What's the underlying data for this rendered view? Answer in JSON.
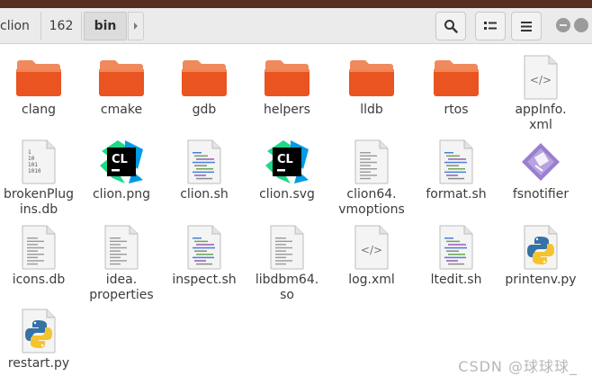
{
  "toolbar": {
    "breadcrumbs": [
      "clion",
      "162",
      "bin"
    ],
    "next_icon": "chevron-right-icon",
    "search_icon": "search-icon",
    "view_icon": "view-options-icon",
    "menu_icon": "hamburger-menu-icon"
  },
  "window_controls": [
    "minimize",
    "close"
  ],
  "files": [
    {
      "name": "clang",
      "type": "folder"
    },
    {
      "name": "cmake",
      "type": "folder"
    },
    {
      "name": "gdb",
      "type": "folder"
    },
    {
      "name": "helpers",
      "type": "folder"
    },
    {
      "name": "lldb",
      "type": "folder"
    },
    {
      "name": "rtos",
      "type": "folder"
    },
    {
      "name": "appInfo.\nxml",
      "type": "xml"
    },
    {
      "name": "brokenPlug\nins.db",
      "type": "binary"
    },
    {
      "name": "clion.png",
      "type": "clion-image"
    },
    {
      "name": "clion.sh",
      "type": "script"
    },
    {
      "name": "clion.svg",
      "type": "clion-image"
    },
    {
      "name": "clion64.\nvmoptions",
      "type": "text"
    },
    {
      "name": "format.sh",
      "type": "script"
    },
    {
      "name": "fsnotifier",
      "type": "executable"
    },
    {
      "name": "icons.db",
      "type": "text"
    },
    {
      "name": "idea.\nproperties",
      "type": "text"
    },
    {
      "name": "inspect.sh",
      "type": "script"
    },
    {
      "name": "libdbm64.\nso",
      "type": "text"
    },
    {
      "name": "log.xml",
      "type": "xml"
    },
    {
      "name": "ltedit.sh",
      "type": "script"
    },
    {
      "name": "printenv.py",
      "type": "python"
    },
    {
      "name": "restart.py",
      "type": "python"
    }
  ],
  "binary_glyph": [
    "1",
    "10",
    "101",
    "1010"
  ],
  "clion_logo_text": "CL",
  "watermark": "CSDN @球球球_",
  "colors": {
    "accent": "#5a2d22",
    "folder": "#e95420",
    "folder_back": "#f08a5d",
    "fsnotifier": "#9b7fcf"
  }
}
